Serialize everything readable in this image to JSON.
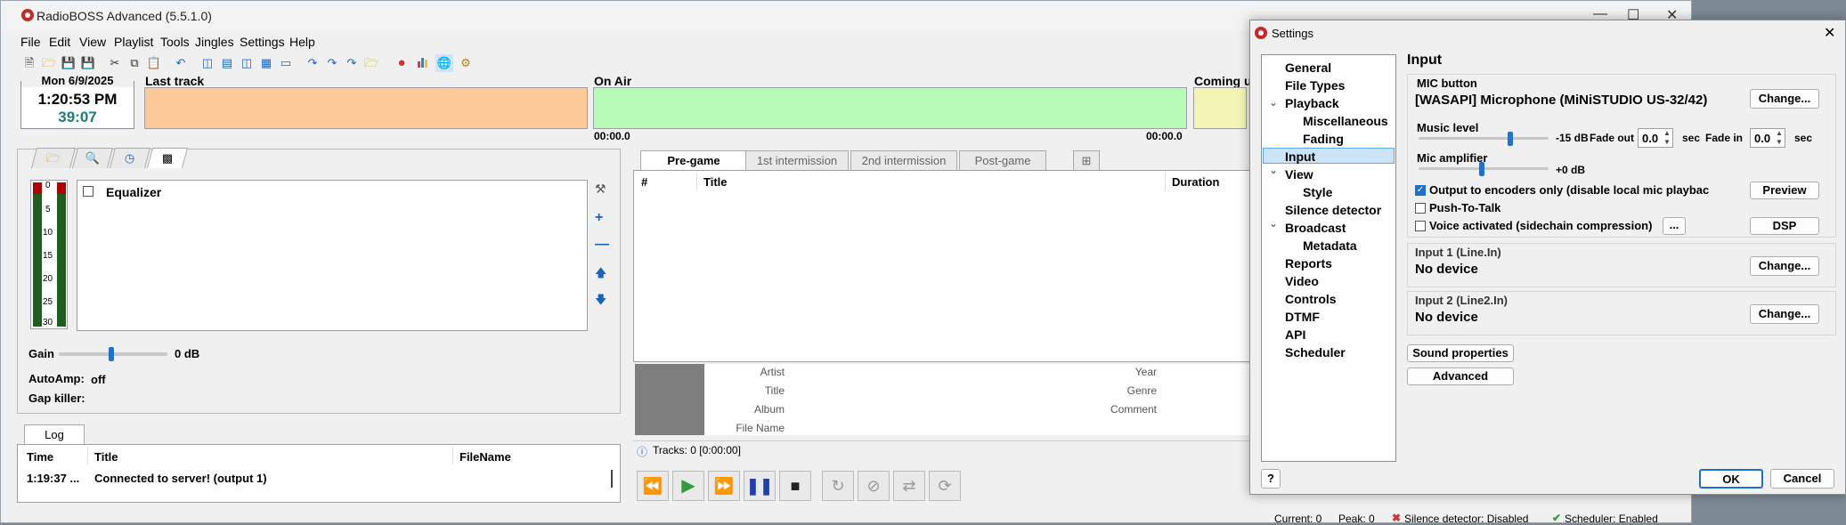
{
  "app": {
    "title": "RadioBOSS Advanced (5.5.1.0)",
    "menu": [
      "File",
      "Edit",
      "View",
      "Playlist",
      "Tools",
      "Jingles",
      "Settings",
      "Help"
    ]
  },
  "clock": {
    "date": "Mon 6/9/2025",
    "time": "1:20:53 PM",
    "countdown": "39:07"
  },
  "decks": {
    "last_track_label": "Last track",
    "on_air_label": "On Air",
    "coming_up_label": "Coming up",
    "on_air_start": "00:00.0",
    "on_air_end": "00:00.0",
    "colors": {
      "last_track": "#fdc998",
      "on_air": "#b6fcb6",
      "coming_up": "#f2f5b3"
    }
  },
  "effects": {
    "meter_ticks": [
      "0",
      "5",
      "10",
      "15",
      "20",
      "25",
      "30"
    ],
    "equalizer_label": "Equalizer",
    "gain_label": "Gain",
    "gain_value": "0 dB",
    "autoamp_label": "AutoAmp:",
    "autoamp_value": "off",
    "gapkiller_label": "Gap killer:"
  },
  "log": {
    "tab": "Log",
    "columns": [
      "Time",
      "Title",
      "FileName"
    ],
    "rows": [
      {
        "time": "1:19:37 ...",
        "title": "Connected to server! (output 1)",
        "file": ""
      }
    ]
  },
  "playlist": {
    "tabs": [
      "Pre-game",
      "1st intermission",
      "2nd intermission",
      "Post-game"
    ],
    "columns": [
      "#",
      "Title",
      "Duration"
    ],
    "info_labels": [
      "Artist",
      "Title",
      "Album",
      "File Name"
    ],
    "info_labels2": [
      "Year",
      "Genre",
      "Comment"
    ],
    "tracks_status": "Tracks: 0 [0:00:00]"
  },
  "statusbar": {
    "current": "Current: 0",
    "peak": "Peak: 0",
    "silence": "Silence detector: Disabled",
    "scheduler": "Scheduler: Enabled"
  },
  "settings": {
    "title": "Settings",
    "tree": [
      {
        "label": "General",
        "level": 0
      },
      {
        "label": "File Types",
        "level": 0
      },
      {
        "label": "Playback",
        "level": 0,
        "expanded": true
      },
      {
        "label": "Miscellaneous",
        "level": 1
      },
      {
        "label": "Fading",
        "level": 1
      },
      {
        "label": "Input",
        "level": 0,
        "selected": true
      },
      {
        "label": "View",
        "level": 0,
        "expanded": true
      },
      {
        "label": "Style",
        "level": 1
      },
      {
        "label": "Silence detector",
        "level": 0
      },
      {
        "label": "Broadcast",
        "level": 0,
        "expanded": true
      },
      {
        "label": "Metadata",
        "level": 1
      },
      {
        "label": "Reports",
        "level": 0
      },
      {
        "label": "Video",
        "level": 0
      },
      {
        "label": "Controls",
        "level": 0
      },
      {
        "label": "DTMF",
        "level": 0
      },
      {
        "label": "API",
        "level": 0
      },
      {
        "label": "Scheduler",
        "level": 0
      }
    ],
    "page_title": "Input",
    "mic": {
      "group": "MIC button",
      "device": "[WASAPI] Microphone (MiNiSTUDIO US-32/42)",
      "change": "Change...",
      "music_level_label": "Music level",
      "music_level_value": "-15 dB",
      "fade_out_label": "Fade out",
      "fade_out_value": "0.0",
      "sec1": "sec",
      "fade_in_label": "Fade in",
      "fade_in_value": "0.0",
      "sec2": "sec",
      "mic_amp_label": "Mic amplifier",
      "mic_amp_value": "+0 dB",
      "output_encoders_label": "Output to encoders only (disable local mic playbac",
      "output_encoders_checked": true,
      "ptt_label": "Push-To-Talk",
      "voice_label": "Voice activated (sidechain compression)",
      "dots": "...",
      "preview": "Preview",
      "dsp": "DSP"
    },
    "input1": {
      "group": "Input 1 (Line.In)",
      "device": "No device",
      "change": "Change..."
    },
    "input2": {
      "group": "Input 2 (Line2.In)",
      "device": "No device",
      "change": "Change..."
    },
    "sound_properties": "Sound properties",
    "advanced": "Advanced",
    "help": "?",
    "ok": "OK",
    "cancel": "Cancel"
  }
}
